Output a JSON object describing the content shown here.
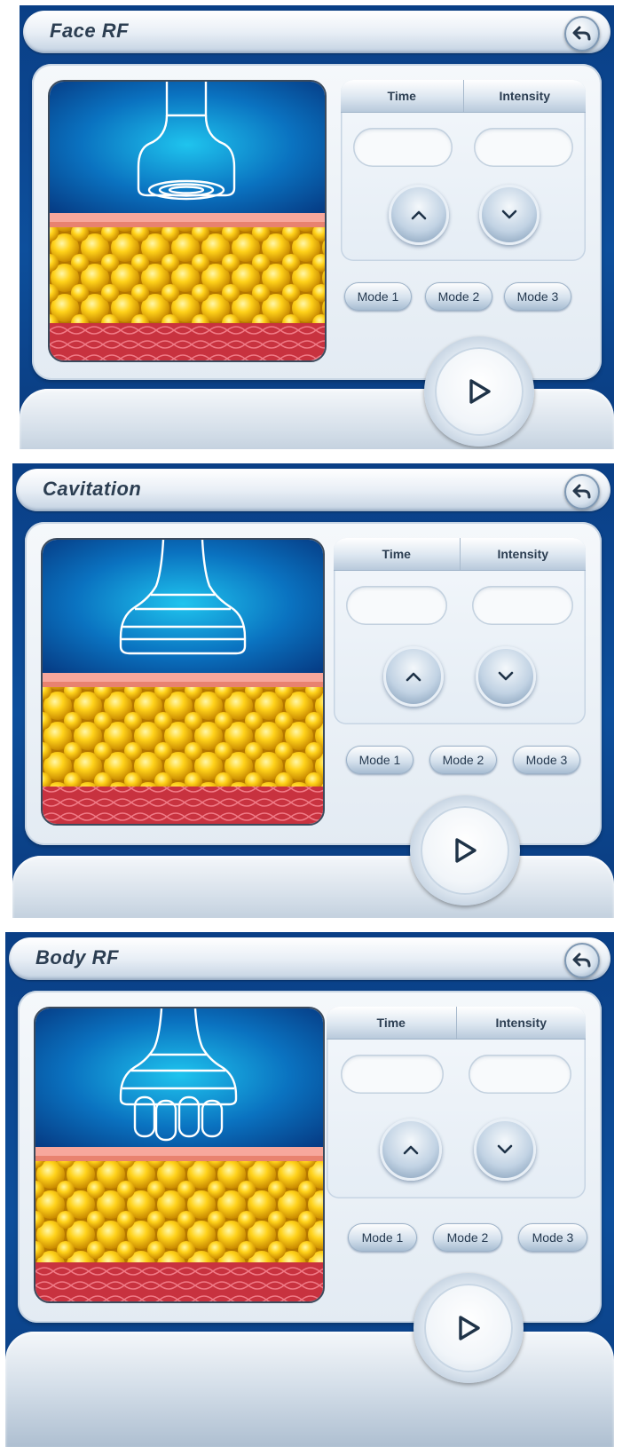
{
  "colors": {
    "frame": "#0d4f9c",
    "accent": "#2c3e52"
  },
  "screens": [
    {
      "title": "Face RF",
      "illustration": "face-rf-applicator",
      "tabs": {
        "time_label": "Time",
        "intensity_label": "Intensity"
      },
      "modes": [
        "Mode 1",
        "Mode 2",
        "Mode 3"
      ]
    },
    {
      "title": "Cavitation",
      "illustration": "cavitation-applicator",
      "tabs": {
        "time_label": "Time",
        "intensity_label": "Intensity"
      },
      "modes": [
        "Mode 1",
        "Mode 2",
        "Mode 3"
      ]
    },
    {
      "title": "Body RF",
      "illustration": "body-rf-applicator",
      "tabs": {
        "time_label": "Time",
        "intensity_label": "Intensity"
      },
      "modes": [
        "Mode 1",
        "Mode 2",
        "Mode 3"
      ]
    }
  ]
}
